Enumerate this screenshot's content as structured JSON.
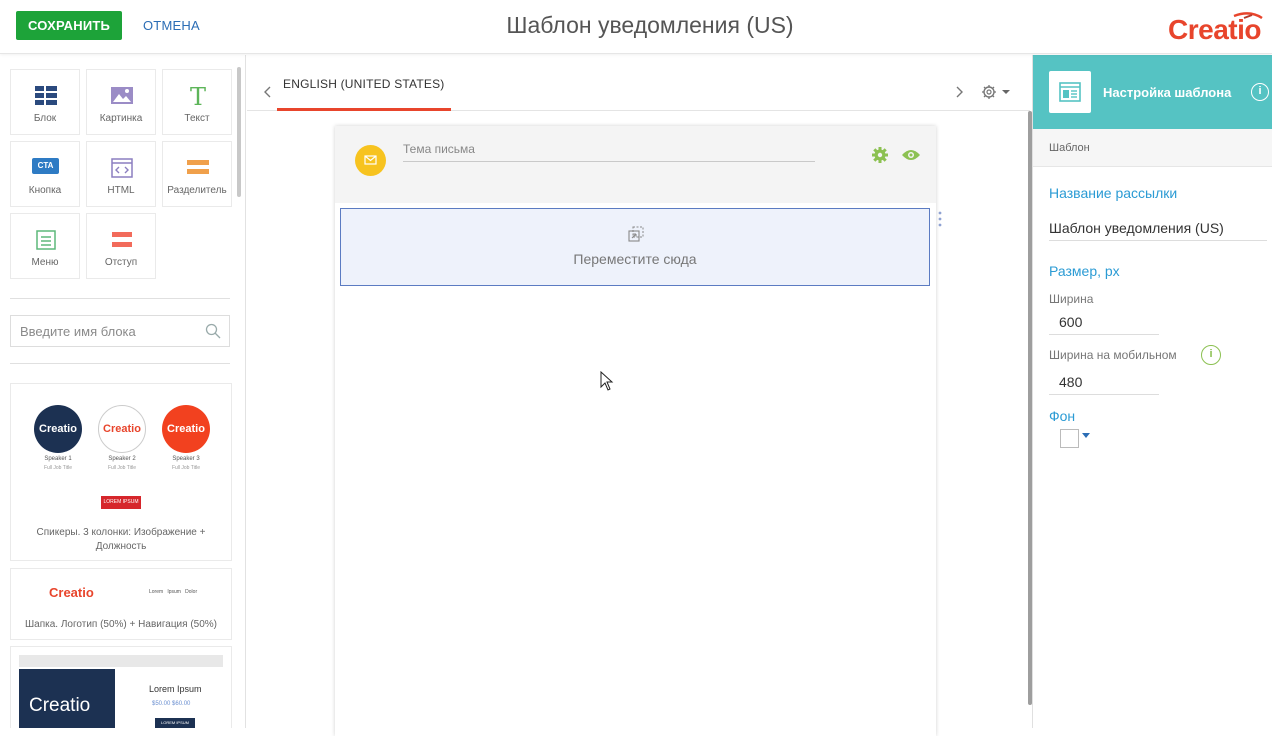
{
  "header": {
    "save_label": "СОХРАНИТЬ",
    "cancel_label": "ОТМЕНА",
    "title": "Шаблон уведомления (US)",
    "logo_text": "Creatio"
  },
  "palette": {
    "tiles": [
      {
        "label": "Блок",
        "icon": "block-grid-icon"
      },
      {
        "label": "Картинка",
        "icon": "image-icon"
      },
      {
        "label": "Текст",
        "icon": "text-t-icon"
      },
      {
        "label": "Кнопка",
        "icon": "cta-button-icon",
        "badge": "CTA"
      },
      {
        "label": "HTML",
        "icon": "html-code-icon"
      },
      {
        "label": "Разделитель",
        "icon": "divider-icon"
      },
      {
        "label": "Меню",
        "icon": "menu-icon"
      },
      {
        "label": "Отступ",
        "icon": "spacer-icon"
      }
    ],
    "search_placeholder": "Введите имя блока",
    "cards": [
      {
        "caption": "Спикеры. 3 колонки: Изображение + Должность",
        "speakers": [
          {
            "logo": "Creatio",
            "name": "Speaker 1",
            "title": "Full Job Title"
          },
          {
            "logo": "Creatio",
            "name": "Speaker 2",
            "title": "Full Job Title"
          },
          {
            "logo": "Creatio",
            "name": "Speaker 3",
            "title": "Full Job Title"
          }
        ],
        "button_text": "LOREM IPSUM"
      },
      {
        "caption": "Шапка. Логотип (50%) + Навигация (50%)",
        "logo": "Creatio",
        "nav": [
          "Lorem",
          "Ipsum",
          "Dolor"
        ]
      },
      {
        "logo": "Creatio",
        "heading": "Lorem Ipsum",
        "prices": "$50.00 $60.00",
        "button_text": "LOREM IPSUM"
      }
    ]
  },
  "editor": {
    "language_tab": "ENGLISH (UNITED STATES)",
    "subject_placeholder": "Тема письма",
    "drop_label": "Переместите сюда"
  },
  "settings": {
    "title": "Настройка шаблона",
    "subheader": "Шаблон",
    "mailing_name_label": "Название рассылки",
    "mailing_name_value": "Шаблон уведомления (US)",
    "size_label": "Размер, px",
    "width_label": "Ширина",
    "width_value": "600",
    "mobile_width_label": "Ширина на мобильном",
    "mobile_width_value": "480",
    "background_label": "Фон",
    "background_color": "#ffffff"
  },
  "colors": {
    "save_green": "#1da339",
    "brand_orange": "#e8452c",
    "teal_header": "#55c3c3",
    "link_blue": "#2b9bd4",
    "icon_green": "#8cc152"
  }
}
